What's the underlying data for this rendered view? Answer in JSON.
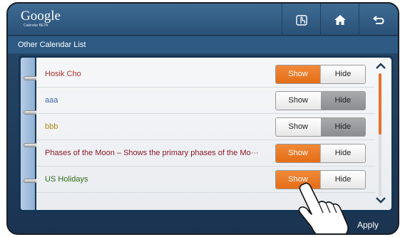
{
  "app": {
    "logo_text": "Google",
    "logo_sub": "Calendar BETA"
  },
  "toolbar": {
    "buttons": [
      {
        "name": "touch-icon"
      },
      {
        "name": "home-icon"
      },
      {
        "name": "back-icon"
      }
    ]
  },
  "header": {
    "title": "Other Calendar List"
  },
  "toggle_labels": {
    "show": "Show",
    "hide": "Hide"
  },
  "calendars": [
    {
      "label": "Hosik Cho",
      "color": "#b0312a",
      "state": "show"
    },
    {
      "label": "aaa",
      "color": "#3a66a8",
      "state": "hide"
    },
    {
      "label": "bbb",
      "color": "#b08a12",
      "state": "hide"
    },
    {
      "label": "Phases of the Moon – Shows the primary phases of the Mo···",
      "color": "#8a1a2a",
      "state": "show"
    },
    {
      "label": "US Holidays",
      "color": "#2f6b16",
      "state": "show"
    }
  ],
  "footer": {
    "apply_label": "Apply"
  },
  "colors": {
    "accent": "#e56d16",
    "bar": "#2a5178"
  }
}
